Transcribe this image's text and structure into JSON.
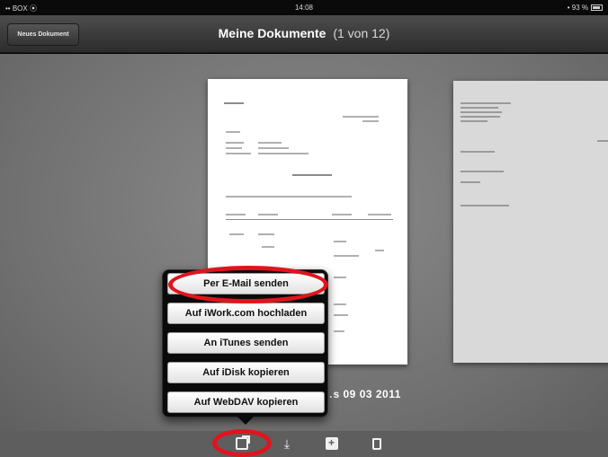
{
  "status_bar": {
    "carrier": "•• BOX ⦿",
    "time": "14:08",
    "battery": "• 93 %"
  },
  "navbar": {
    "new_document_label": "Neues Dokument",
    "title": "Meine Dokumente",
    "count": "(1 von 12)"
  },
  "document": {
    "date": "…s 09 03 2011"
  },
  "popover": {
    "items": [
      {
        "label": "Per E-Mail senden",
        "highlighted": true
      },
      {
        "label": "Auf iWork.com hochladen"
      },
      {
        "label": "An iTunes senden"
      },
      {
        "label": "Auf iDisk kopieren"
      },
      {
        "label": "Auf WebDAV kopieren"
      }
    ]
  },
  "toolbar": {
    "icons": [
      "share-icon",
      "download-icon",
      "add-folder-icon",
      "trash-icon"
    ],
    "share_highlighted": true
  },
  "colors": {
    "highlight_oval": "#e0141e"
  }
}
